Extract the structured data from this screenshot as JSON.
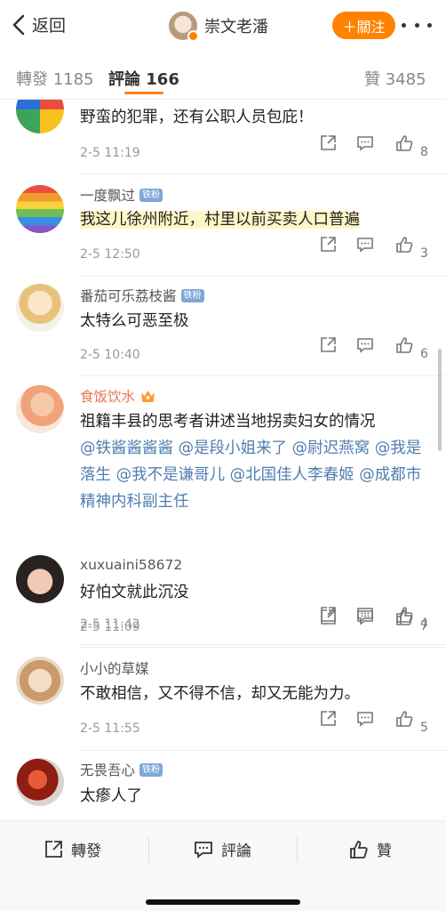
{
  "header": {
    "back_label": "返回",
    "user_name": "崇文老潘",
    "follow_label": "＋關注",
    "more_icon": "more-dots-icon"
  },
  "tabs": {
    "reposts": "轉發 1185",
    "comments": "評論 166",
    "likes": "贊 3485"
  },
  "comments": [
    {
      "name": "",
      "badge": "",
      "text": "野蛮的犯罪，还有公职人员包庇！",
      "time": "2-5 11:19",
      "likes": "8"
    },
    {
      "name": "一度飘过",
      "badge": "铁粉",
      "text": "我这儿徐州附近，村里以前买卖人口普遍",
      "time": "2-5 12:50",
      "likes": "3"
    },
    {
      "name": "番茄可乐荔枝酱",
      "badge": "铁粉",
      "text": "太特么可恶至极",
      "time": "2-5 10:40",
      "likes": "6"
    },
    {
      "name": "食饭饮水",
      "badge": "",
      "text": "祖籍丰县的思考者讲述当地拐卖妇女的情况",
      "mentions": [
        "@铁酱酱酱酱",
        "@是段小姐来了",
        "@尉迟燕窝",
        "@我是落生",
        "@我不是谦哥儿",
        "@北国佳人李春姬",
        "@成都市精神内科副主任"
      ],
      "time": "2-5 11:42",
      "likes": "4"
    },
    {
      "name": "xuxuaini58672",
      "badge": "",
      "text": "好怕文就此沉没",
      "time": "2-5 11:09",
      "likes": "7"
    },
    {
      "name": "小小的草媒",
      "badge": "",
      "text": "不敢相信，又不得不信，却又无能为力。",
      "time": "2-5 11:55",
      "likes": "5"
    },
    {
      "name": "无畏吾心",
      "badge": "铁粉",
      "text": "太瘆人了",
      "time": "",
      "likes": ""
    }
  ],
  "bottom_bar": {
    "repost_label": "轉發",
    "comment_label": "評論",
    "like_label": "贊"
  },
  "colors": {
    "accent": "#ff8200",
    "mention": "#507daf",
    "fan_badge": "#7fa7d8"
  }
}
